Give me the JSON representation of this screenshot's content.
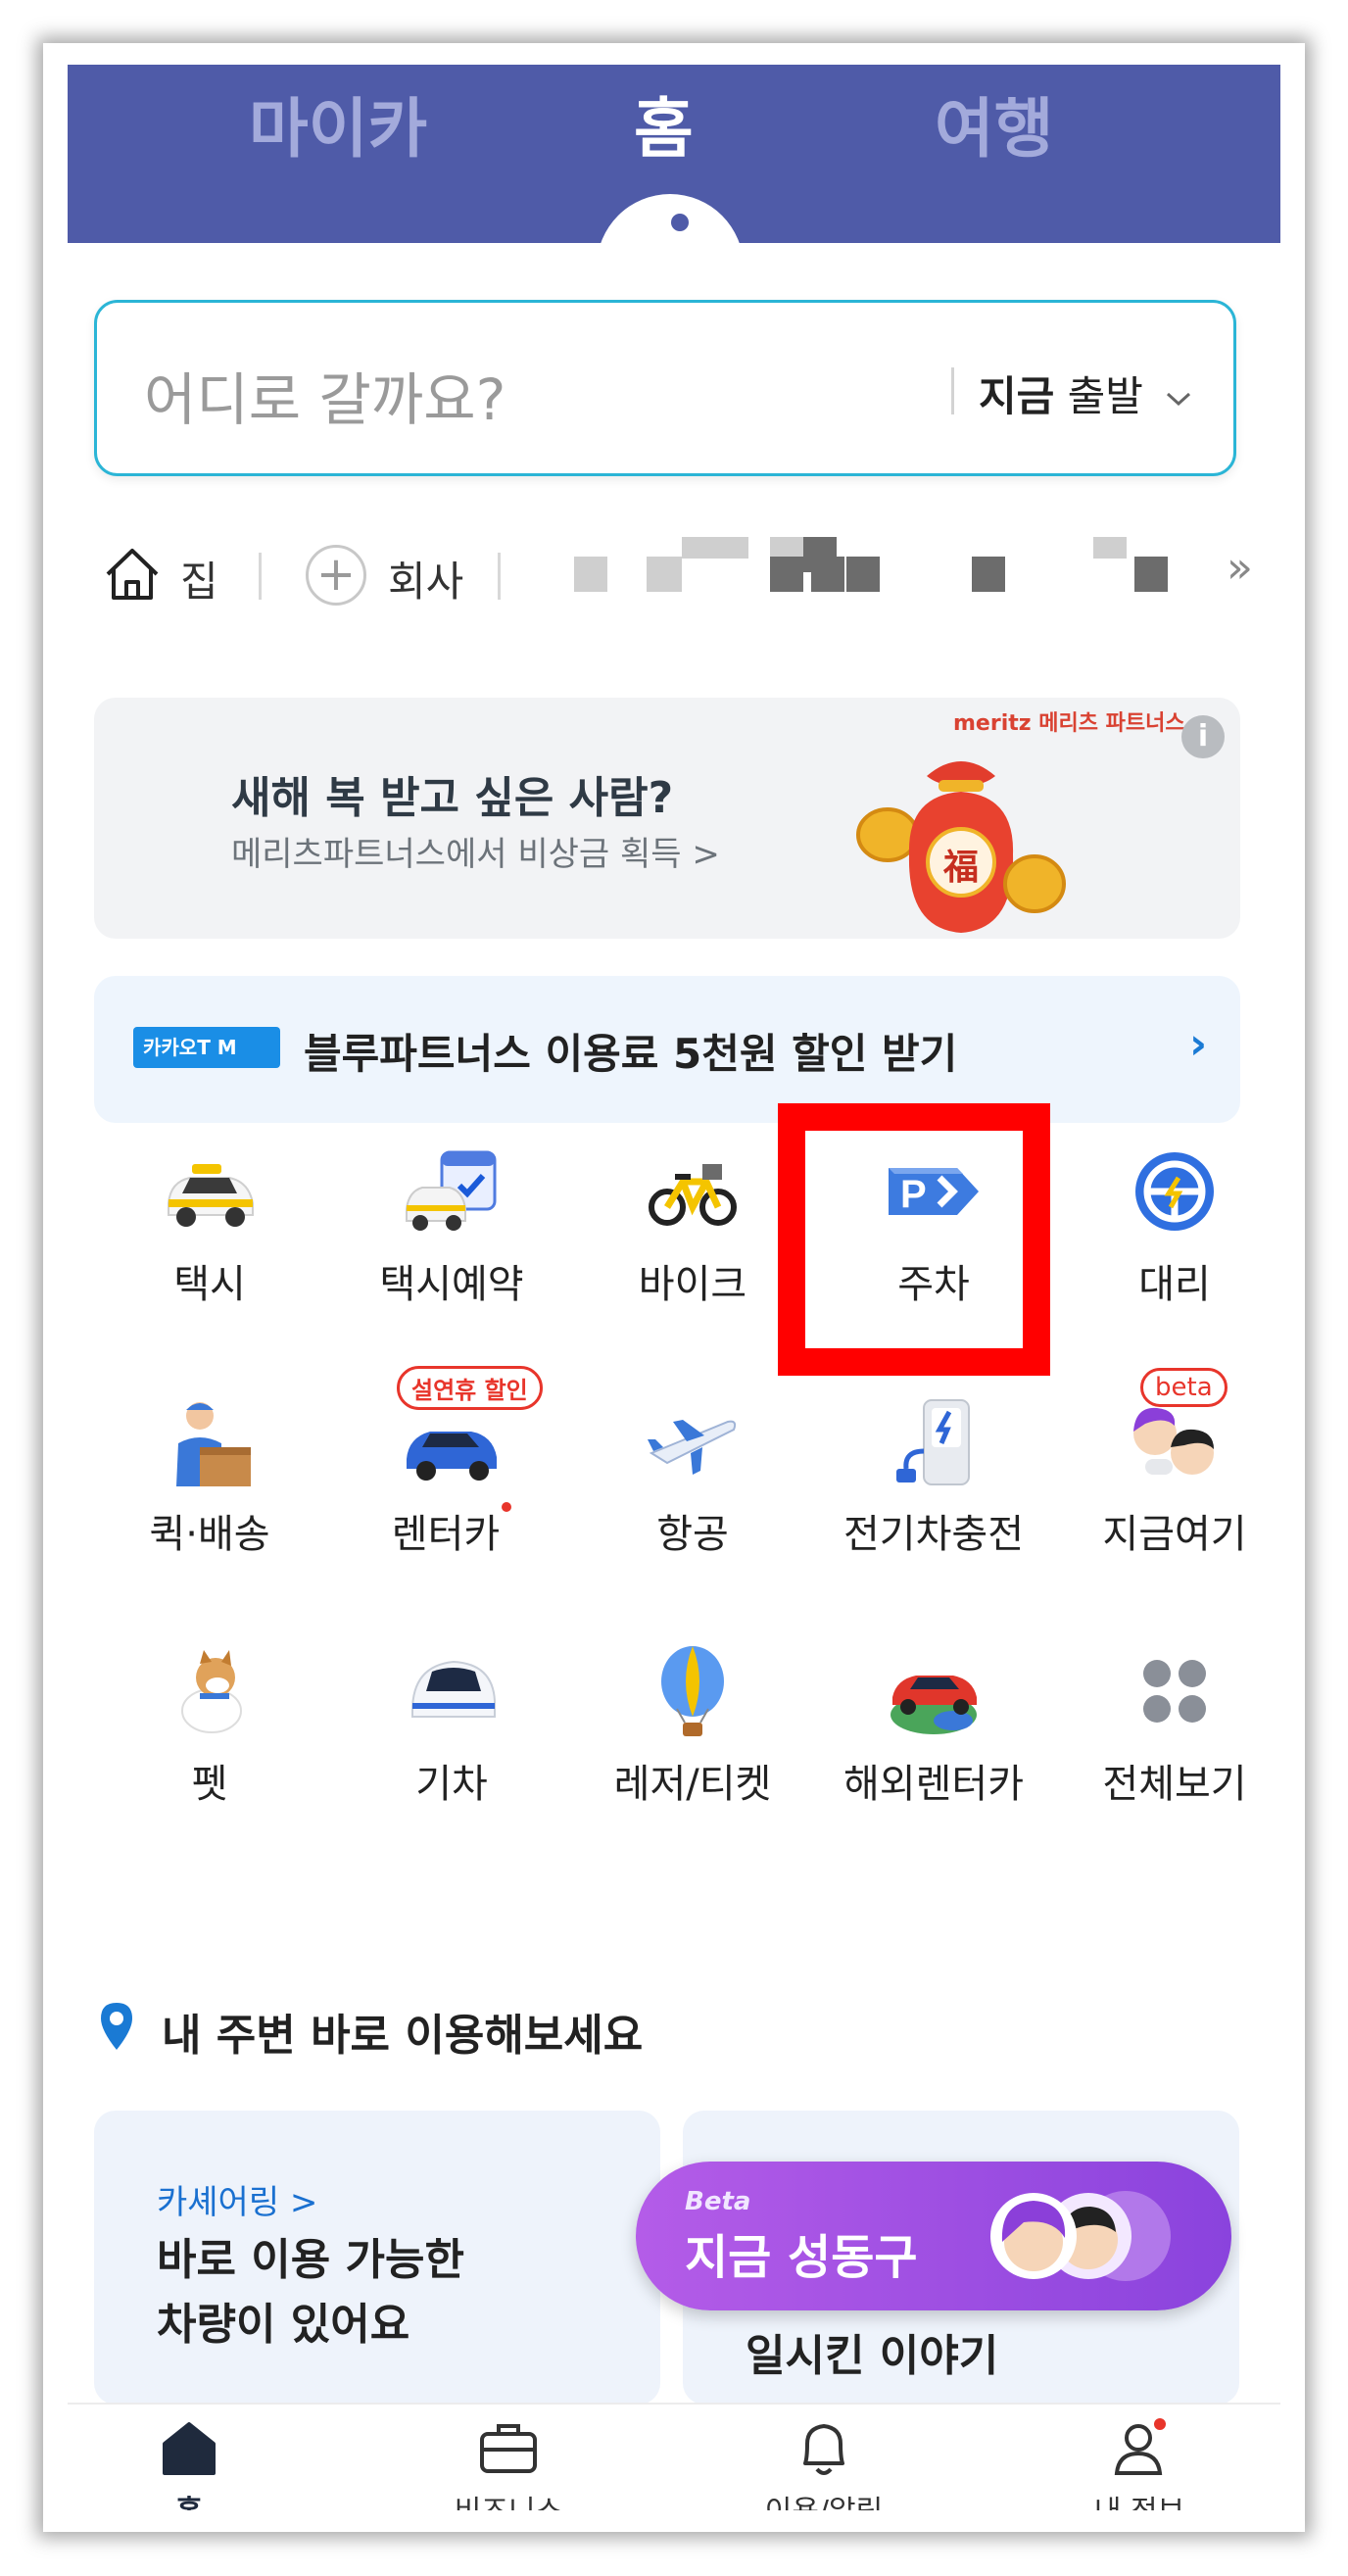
{
  "top_tabs": [
    "마이카",
    "홈",
    "여행"
  ],
  "search": {
    "placeholder": "어디로 갈까요?",
    "time_bold": "지금",
    "time_rest": "출발"
  },
  "shortcuts": {
    "home_label": "집",
    "work_label": "회사",
    "more": "»"
  },
  "promo": {
    "brand": "meritz 메리츠 파트너스",
    "title": "새해 복 받고 싶은 사람?",
    "subtitle": "메리츠파트너스에서 비상금 획득 >",
    "info": "i",
    "bag_char": "福"
  },
  "partners": {
    "badge": "카카오T M",
    "text": "블루파트너스 이용료 5천원 할인 받기",
    "chevron": "›"
  },
  "services": [
    {
      "label": "택시",
      "icon": "taxi-icon"
    },
    {
      "label": "택시예약",
      "icon": "taxi-reservation-icon"
    },
    {
      "label": "바이크",
      "icon": "bike-icon"
    },
    {
      "label": "주차",
      "icon": "parking-icon"
    },
    {
      "label": "대리",
      "icon": "designated-driver-icon"
    },
    {
      "label": "퀵·배송",
      "icon": "delivery-icon"
    },
    {
      "label": "렌터카",
      "icon": "rental-car-icon",
      "badge": "설연휴 할인"
    },
    {
      "label": "항공",
      "icon": "airplane-icon"
    },
    {
      "label": "전기차충전",
      "icon": "ev-charger-icon"
    },
    {
      "label": "지금여기",
      "icon": "now-here-icon",
      "badge": "beta"
    },
    {
      "label": "펫",
      "icon": "pet-icon"
    },
    {
      "label": "기차",
      "icon": "train-icon"
    },
    {
      "label": "레저/티켓",
      "icon": "balloon-icon"
    },
    {
      "label": "해외렌터카",
      "icon": "overseas-rental-icon"
    },
    {
      "label": "전체보기",
      "icon": "grid-icon"
    }
  ],
  "nearby": {
    "title": "내 주변 바로 이용해보세요",
    "card1_kicker": "카셰어링 >",
    "card1_body": "바로 이용 가능한\n차량이 있어요",
    "card2_body": "일시킨 이야기"
  },
  "pill": {
    "beta": "Beta",
    "text": "지금 성동구"
  },
  "bottom_nav": [
    "홈",
    "비즈니스",
    "이용/알림",
    "내 정보"
  ],
  "colors": {
    "header": "#4f5ba8",
    "accent": "#2bb5d6",
    "highlight": "#ff0000"
  }
}
